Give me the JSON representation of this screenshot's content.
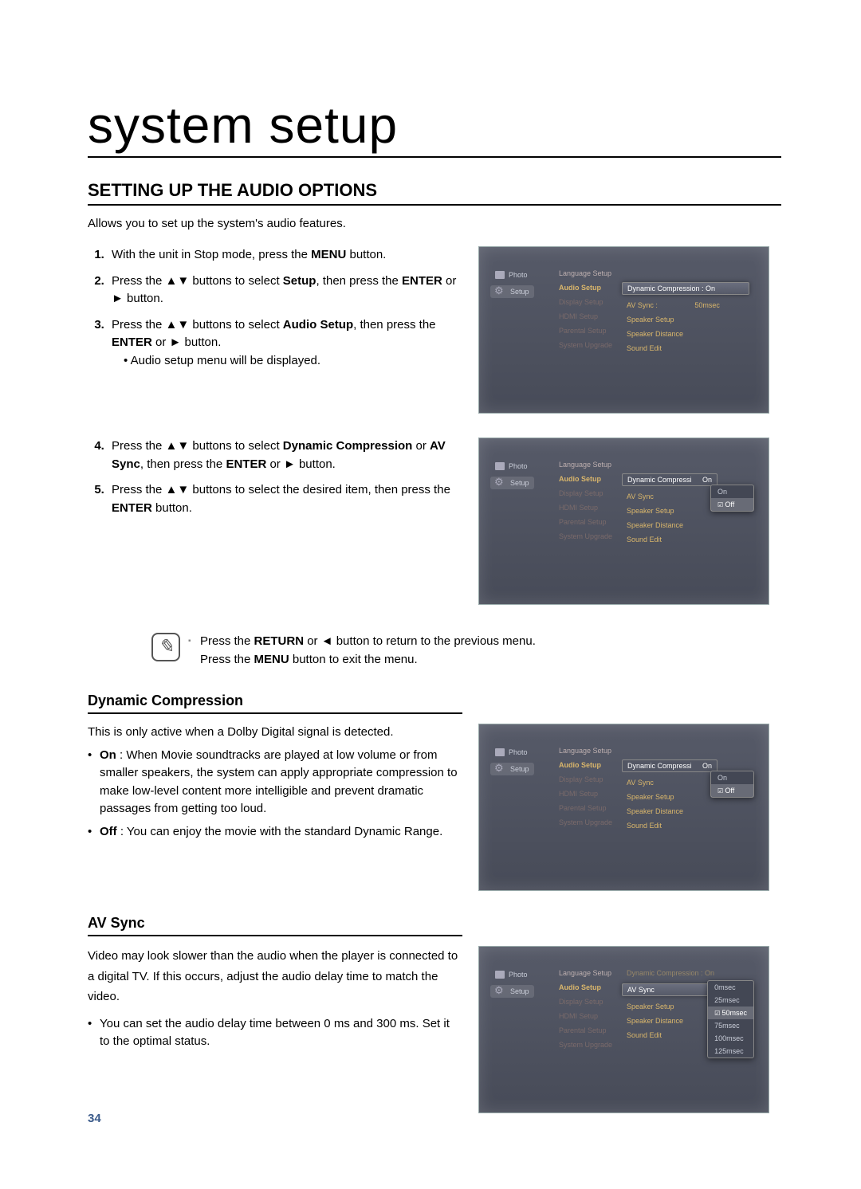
{
  "page": {
    "title": "system setup",
    "section_title": "SETTING UP THE AUDIO OPTIONS",
    "intro": "Allows you to set up the system's audio features.",
    "page_number": "34"
  },
  "steps_a": {
    "s1_a": "With the unit in Stop mode, press the ",
    "s1_b": "MENU",
    "s1_c": " button.",
    "s2_a": "Press the ▲▼ buttons to select ",
    "s2_b": "Setup",
    "s2_c": ", then press the ",
    "s2_d": "ENTER",
    "s2_e": " or ► button.",
    "s3_a": "Press the ▲▼ buttons to select ",
    "s3_b": "Audio Setup",
    "s3_c": ", then press the ",
    "s3_d": "ENTER",
    "s3_e": " or ► button.",
    "s3_sub": "Audio setup menu will be displayed."
  },
  "steps_b": {
    "s4_a": "Press the ▲▼ buttons to select ",
    "s4_b": "Dynamic Compression",
    "s4_c": " or ",
    "s4_d": "AV Sync",
    "s4_e": ", then press the ",
    "s4_f": "ENTER",
    "s4_g": " or ► button.",
    "s5_a": "Press the ▲▼ buttons to select the desired item, then press the ",
    "s5_b": "ENTER",
    "s5_c": " button."
  },
  "note": {
    "line1_a": "Press the ",
    "line1_b": "RETURN",
    "line1_c": " or ◄ button to return to the previous menu.",
    "line2_a": "Press the ",
    "line2_b": "MENU",
    "line2_c": " button to exit the menu."
  },
  "dyn": {
    "title": "Dynamic Compression",
    "intro": "This is only active when a Dolby Digital signal is detected.",
    "on_b": "On",
    "on_txt": " : When Movie soundtracks are played at low volume or from smaller speakers, the system can apply appropriate compression to make low-level content more intelligible and prevent dramatic passages from getting too loud.",
    "off_b": "Off",
    "off_txt": " : You can enjoy the movie with the standard Dynamic Range."
  },
  "av": {
    "title": "AV Sync",
    "p1": "Video may look slower than the audio when the player is connected to a digital TV. If this occurs, adjust the audio delay time to match the video.",
    "b1": "You can set the audio delay time between 0 ms and 300 ms. Set it to the optimal status."
  },
  "menu": {
    "photo": "Photo",
    "setup": "Setup",
    "col2": {
      "lang": "Language Setup",
      "audio": "Audio Setup",
      "display": "Display Setup",
      "hdmi": "HDMI Setup",
      "parental": "Parental Setup",
      "upgrade": "System Upgrade"
    },
    "col3": {
      "dyncomp_on": "Dynamic Compression :  On",
      "dyncomp": "Dynamic Compressi",
      "avsync": "AV Sync :",
      "avsync_short": "AV Sync",
      "avsync_val": "50msec",
      "speaker_setup": "Speaker Setup",
      "speaker_dist": "Speaker Distance",
      "sound_edit": "Sound Edit",
      "on": "On",
      "off": "Off"
    },
    "avlist": {
      "o0": "0msec",
      "o25": "25msec",
      "o50": "50msec",
      "o75": "75msec",
      "o100": "100msec",
      "o125": "125msec"
    }
  }
}
